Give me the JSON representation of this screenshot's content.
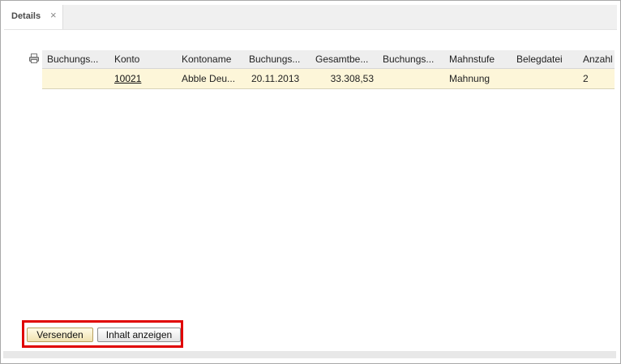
{
  "tab": {
    "label": "Details",
    "close_glyph": "×"
  },
  "toolbar": {
    "print_icon": "printer-icon"
  },
  "grid": {
    "columns": [
      "Buchungs...",
      "Konto",
      "Kontoname",
      "Buchungs...",
      "Gesamtbe...",
      "Buchungs...",
      "Mahnstufe",
      "Belegdatei",
      "Anzahl"
    ],
    "rows": [
      [
        "",
        "10021",
        "Abble Deu...",
        "20.11.2013",
        "33.308,53",
        "",
        "Mahnung",
        "",
        "2"
      ]
    ]
  },
  "buttons": {
    "send": "Versenden",
    "show_content": "Inhalt anzeigen"
  },
  "colors": {
    "highlight": "#e00000",
    "selected_row": "#fdf6d9"
  }
}
